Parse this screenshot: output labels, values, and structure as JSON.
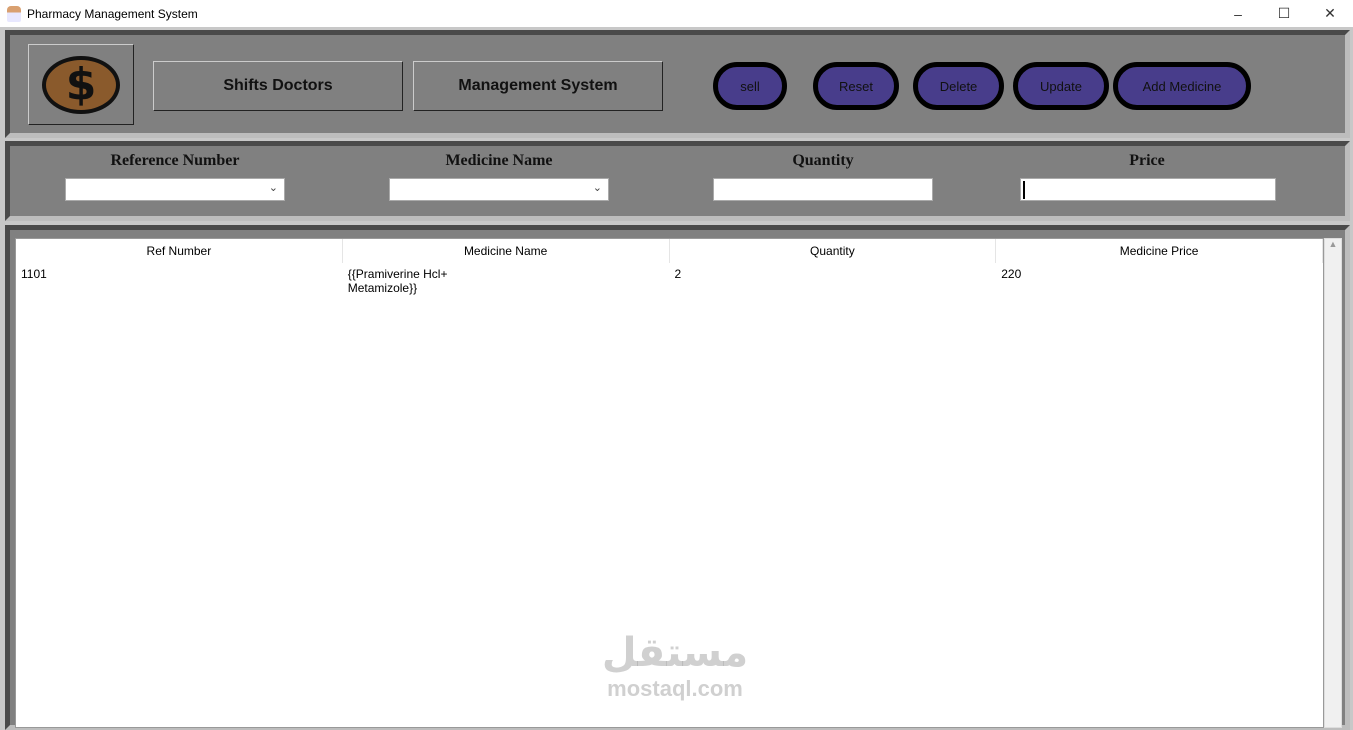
{
  "window": {
    "title": "Pharmacy Management System",
    "minimize": "–",
    "maximize": "☐",
    "close": "✕"
  },
  "toolbar": {
    "logo_symbol": "$",
    "shifts_doctors": "Shifts Doctors",
    "management_system": "Management System",
    "sell": "sell",
    "reset": "Reset",
    "delete": "Delete",
    "update": "Update",
    "add_medicine": "Add Medicine"
  },
  "form": {
    "reference_number": "Reference Number",
    "medicine_name": "Medicine Name",
    "quantity": "Quantity",
    "price": "Price"
  },
  "table": {
    "headers": [
      "Ref Number",
      "Medicine Name",
      "Quantity",
      "Medicine Price"
    ],
    "rows": [
      {
        "ref": "1101",
        "name_line1": "{{Pramiverine Hcl+",
        "name_line2": "Metamizole}}",
        "qty": "2",
        "price": "220"
      }
    ]
  },
  "watermark": {
    "arabic": "مستقل",
    "latin": "mostaql.com"
  },
  "colors": {
    "panel": "#808080",
    "button": "#483d8b"
  }
}
